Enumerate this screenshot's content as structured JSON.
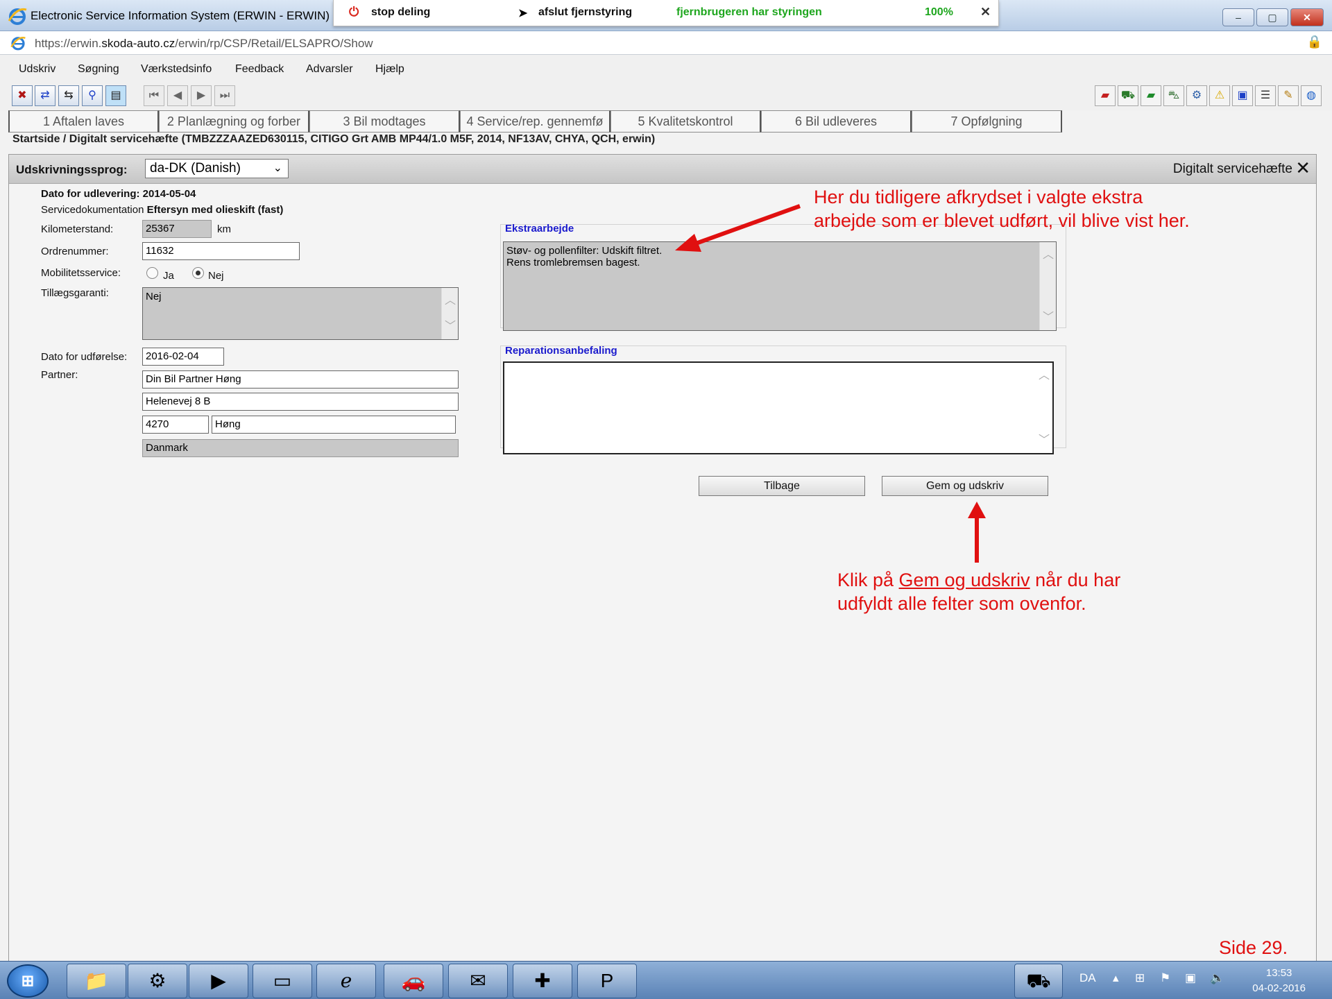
{
  "window": {
    "title": "Electronic Service Information System (ERWIN - ERWIN)",
    "controls": [
      "–",
      "▢",
      "✕"
    ]
  },
  "sharebar": {
    "stop_label": "stop deling",
    "release_label": "afslut fjernstyring",
    "remote_status": "fjernbrugeren har styringen",
    "zoom": "100%"
  },
  "address": {
    "url_prefix": "https://erwin.",
    "url_domain": "skoda-auto.cz",
    "url_path": "/erwin/rp/CSP/Retail/ELSAPRO/Show"
  },
  "menu": [
    "Udskriv",
    "Søgning",
    "Værkstedsinfo",
    "Feedback",
    "Advarsler",
    "Hjælp"
  ],
  "tabs": [
    "1 Aftalen laves",
    "2 Planlægning og forber",
    "3 Bil modtages",
    "4 Service/rep. gennemfø",
    "5 Kvalitetskontrol",
    "6 Bil udleveres",
    "7 Opfølgning"
  ],
  "breadcrumb": "Startside / Digitalt servicehæfte (TMBZZZAAZED630115, CITIGO Grt AMB MP44/1.0 M5F, 2014, NF13AV, CHYA, QCH, erwin)",
  "panel": {
    "language_label": "Udskrivningssprog:",
    "language_value": "da-DK (Danish)",
    "title": "Digitalt servicehæfte"
  },
  "form": {
    "delivery_date": "Dato for udlevering: 2014-05-04",
    "service_doc_label": "Servicedokumentation",
    "service_doc_value": "Eftersyn med olieskift (fast)",
    "km_label": "Kilometerstand:",
    "km_value": "25367",
    "km_unit": "km",
    "order_label": "Ordrenummer:",
    "order_value": "11632",
    "mobility_label": "Mobilitetsservice:",
    "mobility_yes": "Ja",
    "mobility_no": "Nej",
    "warranty_label": "Tillægsgaranti:",
    "warranty_value": "Nej",
    "exec_date_label": "Dato for udførelse:",
    "exec_date_value": "2016-02-04",
    "partner_label": "Partner:",
    "partner_name": "Din Bil Partner Høng",
    "partner_street": "Helenevej 8 B",
    "partner_zip": "4270",
    "partner_city": "Høng",
    "partner_country": "Danmark"
  },
  "extra": {
    "legend": "Ekstraarbejde",
    "line1": "Støv- og pollenfilter: Udskift filtret.",
    "line2": "Rens tromlebremsen bagest."
  },
  "repair": {
    "legend": "Reparationsanbefaling",
    "value": ""
  },
  "buttons": {
    "back": "Tilbage",
    "save_print": "Gem og udskriv"
  },
  "annotations": {
    "top_line1": "Her du tidligere afkrydset i valgte ekstra",
    "top_line2": "arbejde som er blevet udført, vil blive vist her.",
    "bottom_prefix": "Klik på ",
    "bottom_link": "Gem og udskriv",
    "bottom_suffix": " når du har",
    "bottom_line2": "udfyldt alle felter som ovenfor.",
    "page_number": "Side 29."
  },
  "taskbar": {
    "language": "DA",
    "time": "13:53",
    "date": "04-02-2016"
  },
  "colors": {
    "annotation": "#e01010",
    "legend": "#1a1acd",
    "remote_green": "#1ea61e"
  }
}
